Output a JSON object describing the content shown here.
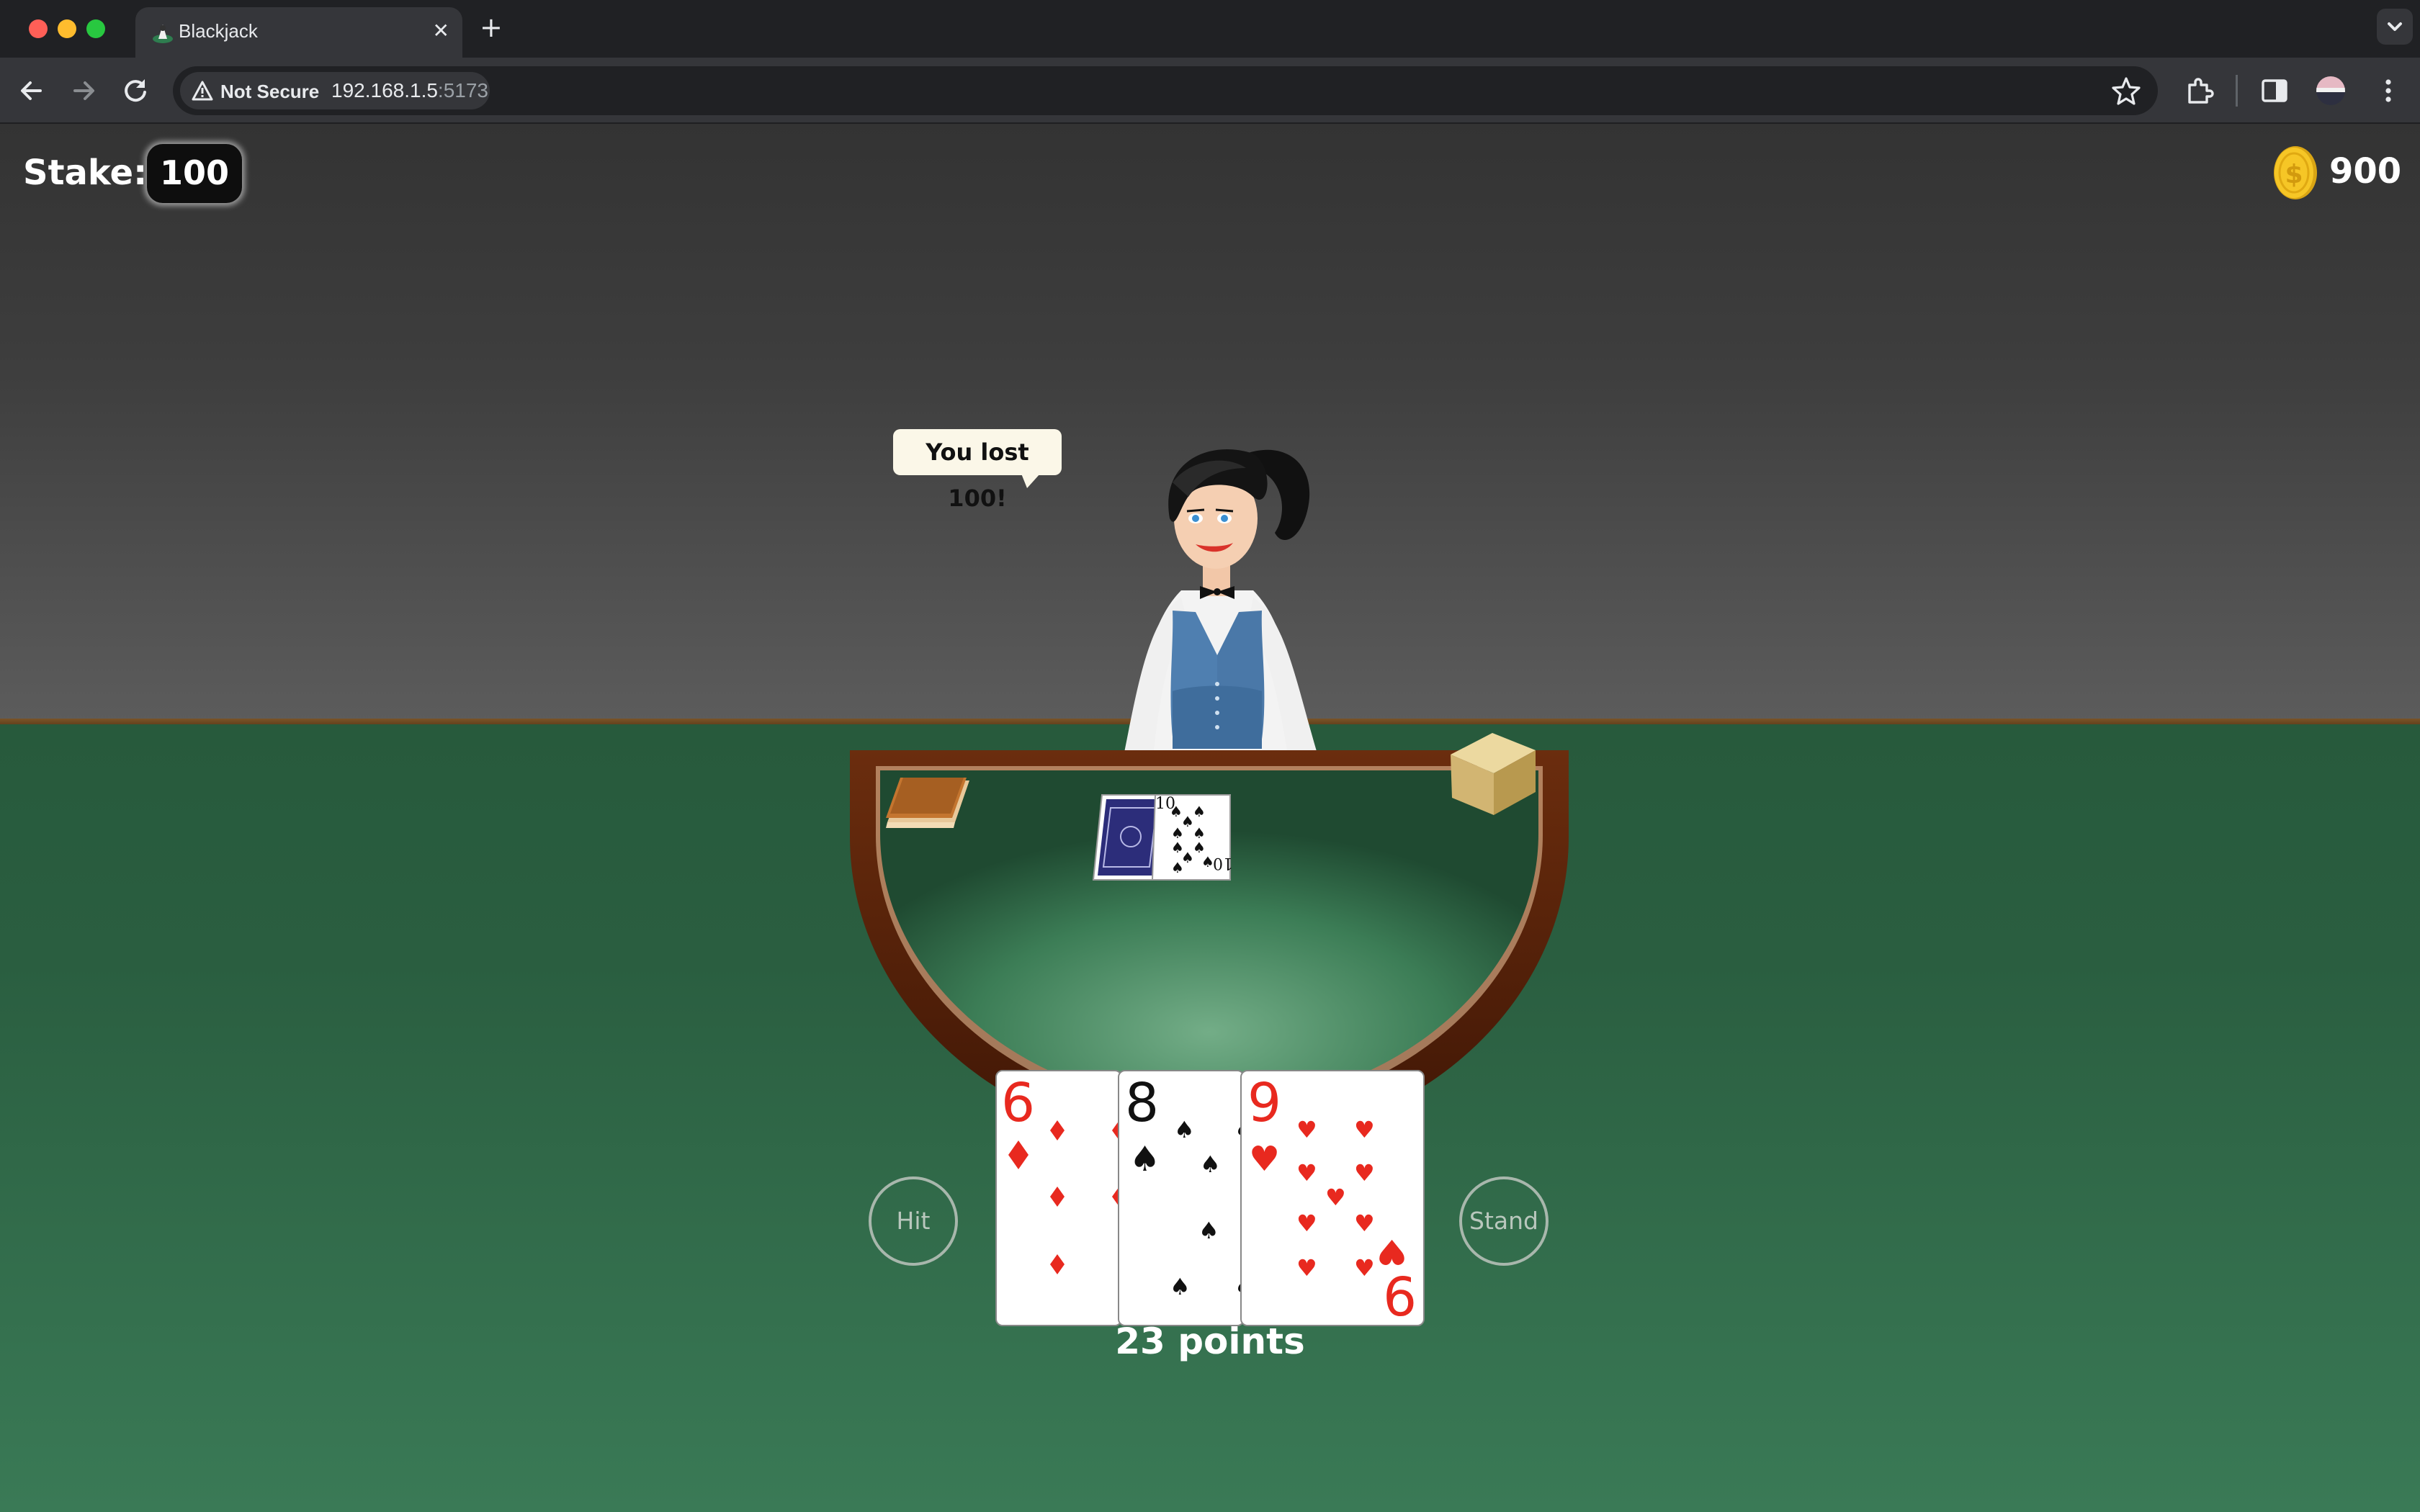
{
  "browser": {
    "tab_title": "Blackjack",
    "tab_close": "✕",
    "new_tab": "+",
    "security_label": "Not Secure",
    "url_host": "192.168.1.5",
    "url_port": ":5173"
  },
  "hud": {
    "stake_label": "Stake:",
    "stake_value": "100",
    "balance": "900"
  },
  "dealer": {
    "speech": "You lost 100!"
  },
  "dealer_hand": {
    "face_up_card": {
      "rank": "10",
      "suit": "spades"
    },
    "hidden_cards": 1
  },
  "player_hand": {
    "cards": [
      {
        "rank": "6",
        "suit": "diamonds"
      },
      {
        "rank": "8",
        "suit": "spades"
      },
      {
        "rank": "9",
        "suit": "hearts"
      }
    ],
    "points_text": "23 points"
  },
  "actions": {
    "hit": "Hit",
    "stand": "Stand"
  },
  "colors": {
    "felt": "#2c6042",
    "red_suit": "#e8291f",
    "black_suit": "#111111",
    "coin": "#f3c122"
  },
  "icons": [
    "back-arrow-icon",
    "forward-arrow-icon",
    "reload-icon",
    "warning-icon",
    "star-icon",
    "extensions-icon",
    "side-panel-icon",
    "profile-avatar",
    "menu-icon",
    "coin-icon"
  ]
}
